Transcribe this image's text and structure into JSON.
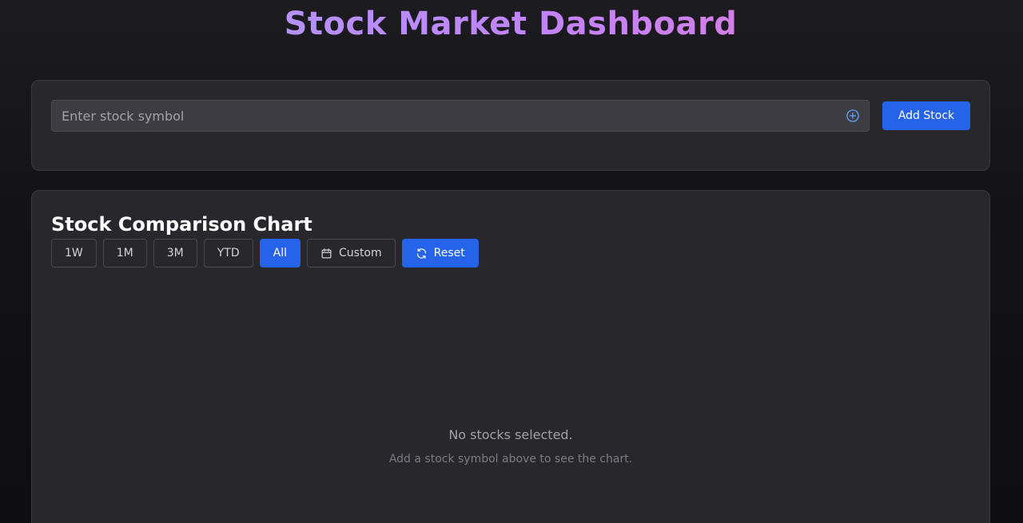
{
  "header": {
    "title": "Stock Market Dashboard"
  },
  "stock_input": {
    "placeholder": "Enter stock symbol",
    "value": "",
    "add_icon": "plus-circle-icon",
    "add_button_label": "Add Stock"
  },
  "chart_panel": {
    "title": "Stock Comparison Chart",
    "ranges": [
      {
        "label": "1W",
        "active": false
      },
      {
        "label": "1M",
        "active": false
      },
      {
        "label": "3M",
        "active": false
      },
      {
        "label": "YTD",
        "active": false
      },
      {
        "label": "All",
        "active": true
      }
    ],
    "custom_label": "Custom",
    "custom_icon": "calendar-icon",
    "reset_label": "Reset",
    "reset_icon": "refresh-icon",
    "empty_title": "No stocks selected.",
    "empty_subtitle": "Add a stock symbol above to see the chart."
  },
  "colors": {
    "accent": "#2563eb",
    "title_gradient_start": "#a5a4f7",
    "title_gradient_end": "#e879c9",
    "card_background": "#27272c"
  }
}
